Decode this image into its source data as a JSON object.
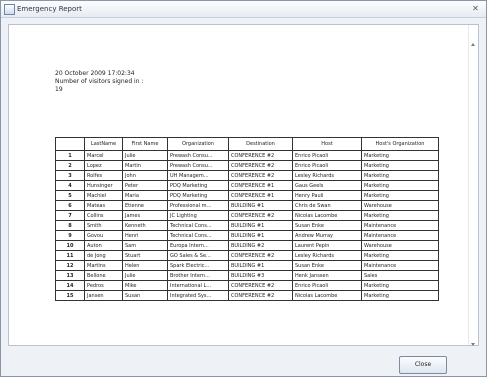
{
  "window": {
    "title": "Emergency Report"
  },
  "report": {
    "datetime": "20 October 2009   17:02:34",
    "visitors_label": "Number of visitors signed in :",
    "visitors_count": "19",
    "columns": [
      "",
      "LastName",
      "First Name",
      "Organization",
      "Destination",
      "Host",
      "Host's Organization"
    ],
    "rows": [
      [
        "1",
        "Marcel",
        "Julie",
        "Prewash Consu...",
        "CONFERENCE #2",
        "Enrico Picaoli",
        "Marketing"
      ],
      [
        "2",
        "Lopez",
        "Martin",
        "Prewash Consu...",
        "CONFERENCE #2",
        "Enrico Picaoli",
        "Marketing"
      ],
      [
        "3",
        "Rolfes",
        "John",
        "UH Managem...",
        "CONFERENCE #2",
        "Lesley Richards",
        "Marketing"
      ],
      [
        "4",
        "Hunsinger",
        "Peter",
        "PDQ Marketing",
        "CONFERENCE #1",
        "Gaus Geels",
        "Marketing"
      ],
      [
        "5",
        "Machiel",
        "Maria",
        "PDQ Marketing",
        "CONFERENCE #1",
        "Henry Pauli",
        "Marketing"
      ],
      [
        "6",
        "Mateas",
        "Etienne",
        "Professional m...",
        "BUILDING #1",
        "Chris de Swan",
        "Warehouse"
      ],
      [
        "7",
        "Collins",
        "James",
        "JC Lighting",
        "CONFERENCE #2",
        "Nicolas Lacombe",
        "Marketing"
      ],
      [
        "8",
        "Smith",
        "Kenneth",
        "Technical Cons...",
        "BUILDING #1",
        "Susan Enke",
        "Maintenance"
      ],
      [
        "9",
        "Govou",
        "Henri",
        "Technical Cons...",
        "BUILDING #1",
        "Andrew Murray",
        "Maintenance"
      ],
      [
        "10",
        "Auton",
        "Sam",
        "Europa Intern...",
        "BUILDING #2",
        "Laurent Pepin",
        "Warehouse"
      ],
      [
        "11",
        "de Jong",
        "Stuart",
        "GO Sales & Se...",
        "CONFERENCE #2",
        "Lesley Richards",
        "Marketing"
      ],
      [
        "12",
        "Martins",
        "Helen",
        "Spark Electric...",
        "BUILDING #1",
        "Susan Enke",
        "Maintenance"
      ],
      [
        "13",
        "Bellone",
        "Julie",
        "Brother Intern...",
        "BUILDING #3",
        "Henk Janssen",
        "Sales"
      ],
      [
        "14",
        "Pedros",
        "Mike",
        "International L...",
        "CONFERENCE #2",
        "Enrico Picaoli",
        "Marketing"
      ],
      [
        "15",
        "Jansen",
        "Susan",
        "Integrated Sys...",
        "CONFERENCE #2",
        "Nicolas Lacombe",
        "Marketing"
      ]
    ]
  },
  "footer": {
    "close_label": "Close"
  },
  "icons": {
    "app": "report-icon",
    "close": "close-icon"
  }
}
